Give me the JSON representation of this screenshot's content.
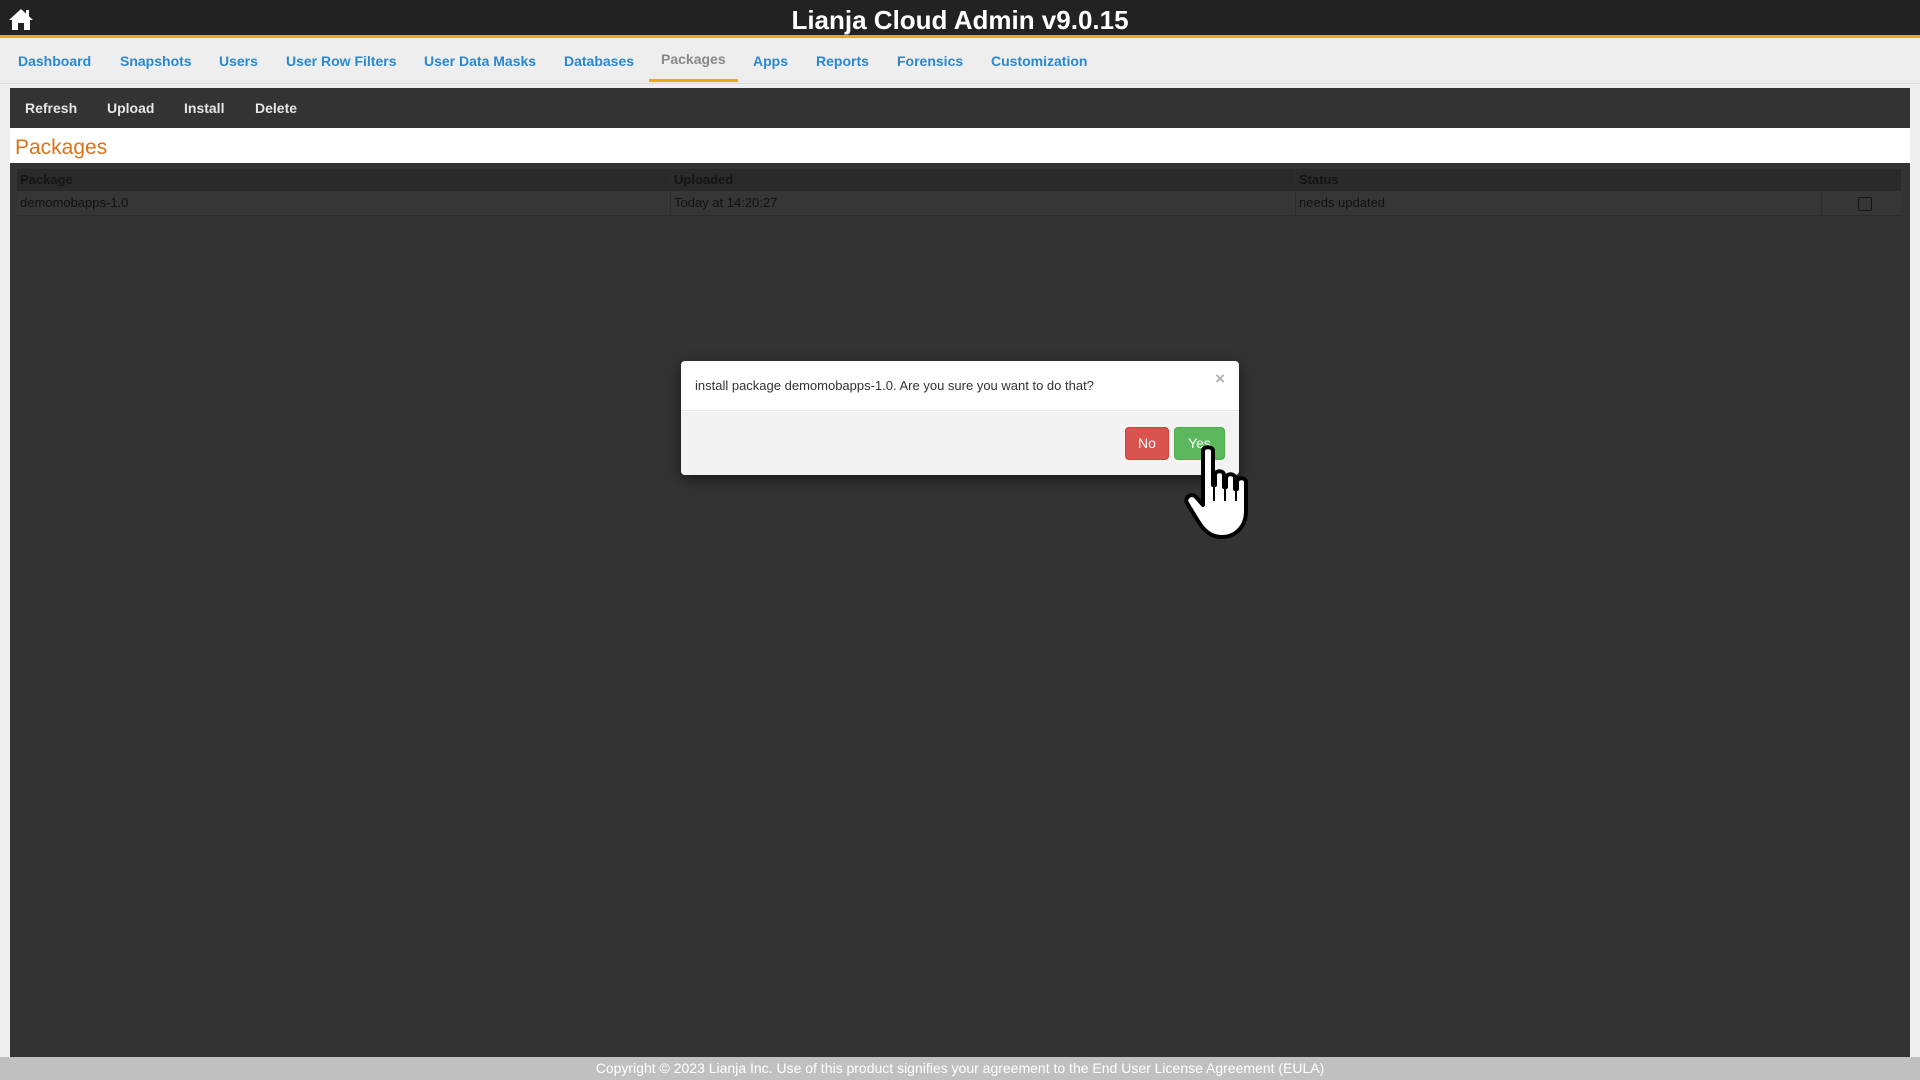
{
  "header": {
    "title": "Lianja Cloud Admin v9.0.15",
    "home_icon": "home-icon"
  },
  "nav": {
    "tabs": [
      {
        "label": "Dashboard"
      },
      {
        "label": "Snapshots"
      },
      {
        "label": "Users"
      },
      {
        "label": "User Row Filters"
      },
      {
        "label": "User Data Masks"
      },
      {
        "label": "Databases"
      },
      {
        "label": "Packages",
        "active": true
      },
      {
        "label": "Apps"
      },
      {
        "label": "Reports"
      },
      {
        "label": "Forensics"
      },
      {
        "label": "Customization"
      }
    ]
  },
  "toolbar": {
    "refresh_label": "Refresh",
    "upload_label": "Upload",
    "install_label": "Install",
    "delete_label": "Delete"
  },
  "section": {
    "title": "Packages"
  },
  "table": {
    "columns": [
      "Package",
      "Uploaded",
      "Status",
      ""
    ],
    "rows": [
      {
        "package": "demomobapps-1.0",
        "uploaded": "Today at 14:20:27",
        "status": "needs updated",
        "selected": false
      }
    ]
  },
  "dialog": {
    "message": "install package demomobapps-1.0. Are you sure you want to do that?",
    "close_glyph": "×",
    "no_label": "No",
    "yes_label": "Yes"
  },
  "footer": {
    "text": "Copyright © 2023 Lianja Inc. Use of this product signifies your agreement to the End User License Agreement (EULA)"
  },
  "colors": {
    "accent": "#f5a511",
    "nav_link": "#2a88d0",
    "section_title": "#d9731a",
    "no_button": "#d9534f",
    "yes_button": "#5cb85c"
  }
}
